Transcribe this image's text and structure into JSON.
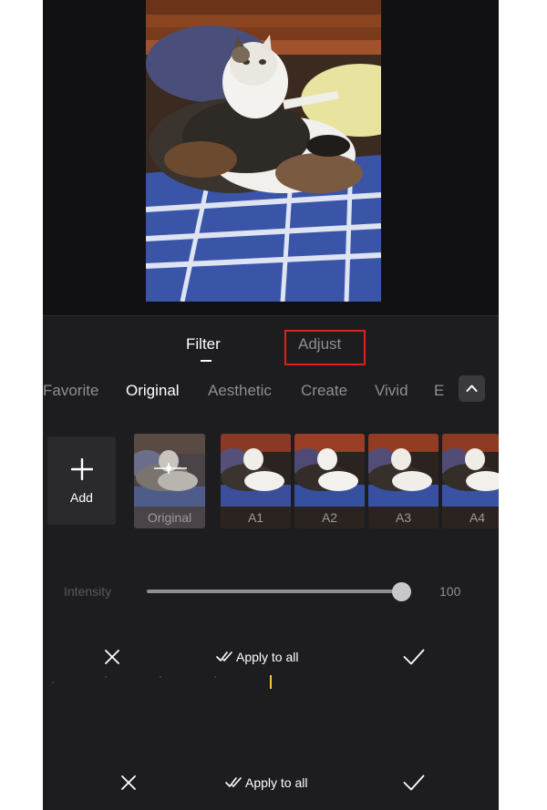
{
  "tabs": {
    "filter_label": "Filter",
    "adjust_label": "Adjust"
  },
  "categories": [
    "Favorite",
    "Original",
    "Aesthetic",
    "Create",
    "Vivid",
    "E"
  ],
  "active_category": "Original",
  "add_button": {
    "label": "Add",
    "icon": "plus-icon"
  },
  "filters": [
    {
      "label": "Original"
    },
    {
      "label": "A1"
    },
    {
      "label": "A2"
    },
    {
      "label": "A3"
    },
    {
      "label": "A4"
    }
  ],
  "intensity": {
    "label": "Intensity",
    "value": "100",
    "level": 1.0
  },
  "action_bar_1": {
    "apply_all_label": "Apply to all"
  },
  "action_bar_2": {
    "apply_all_label": "Apply to all"
  },
  "colors": {
    "highlight_box": "#e02020",
    "playhead": "#f5c542",
    "panel_bg": "#1d1d1f"
  }
}
